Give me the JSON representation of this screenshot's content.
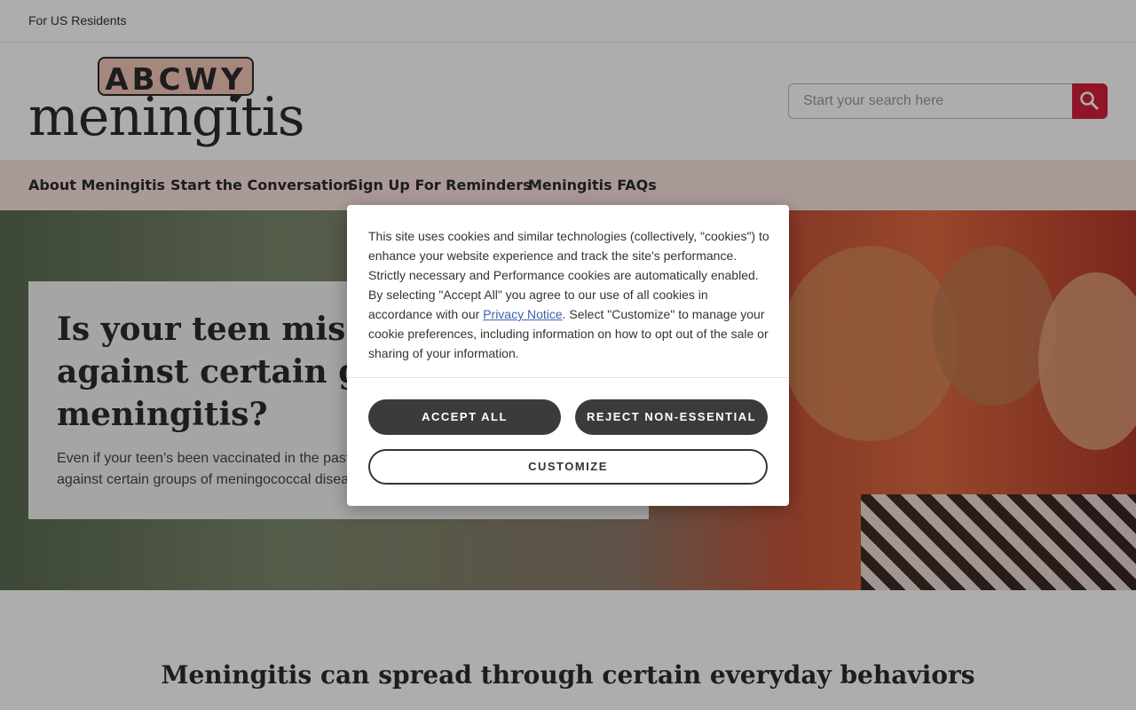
{
  "topbar": {
    "label": "For US Residents"
  },
  "logo": {
    "badge": "ABCWY",
    "word": "meningitis"
  },
  "search": {
    "placeholder": "Start your search here"
  },
  "nav": {
    "items": [
      {
        "label": "About Meningitis"
      },
      {
        "label": "Start the Conversation"
      },
      {
        "label": "Sign Up For Reminders"
      },
      {
        "label": "Meningitis FAQs"
      }
    ]
  },
  "hero": {
    "title": "Is your teen missing protection against certain groups of meningitis?",
    "title_visible": [
      "Is your teen missin",
      "against certain gro",
      "meningitis?"
    ],
    "subtitle_visible": [
      "Even if your teen's been vaccinated in the past",
      "against certain groups of meningococcal disea"
    ]
  },
  "section": {
    "title": "Meningitis can spread through certain everyday behaviors"
  },
  "cookie": {
    "text_before": "This site uses cookies and similar technologies (collectively, \"cookies\") to enhance your website experience and track the site's performance. Strictly necessary and Performance cookies are automatically enabled. By selecting \"Accept All\" you agree to our use of all cookies in accordance with our ",
    "link": "Privacy Notice",
    "text_after": ". Select \"Customize\" to manage your cookie preferences, including information on how to opt out of the sale or sharing of your information.",
    "accept_label": "ACCEPT ALL",
    "reject_label": "REJECT NON-ESSENTIAL",
    "customize_label": "CUSTOMIZE"
  },
  "colors": {
    "accent": "#d51f3a",
    "nav_bg": "#fbe3df",
    "button_dark": "#3b3b3b",
    "link": "#3b62b5"
  }
}
